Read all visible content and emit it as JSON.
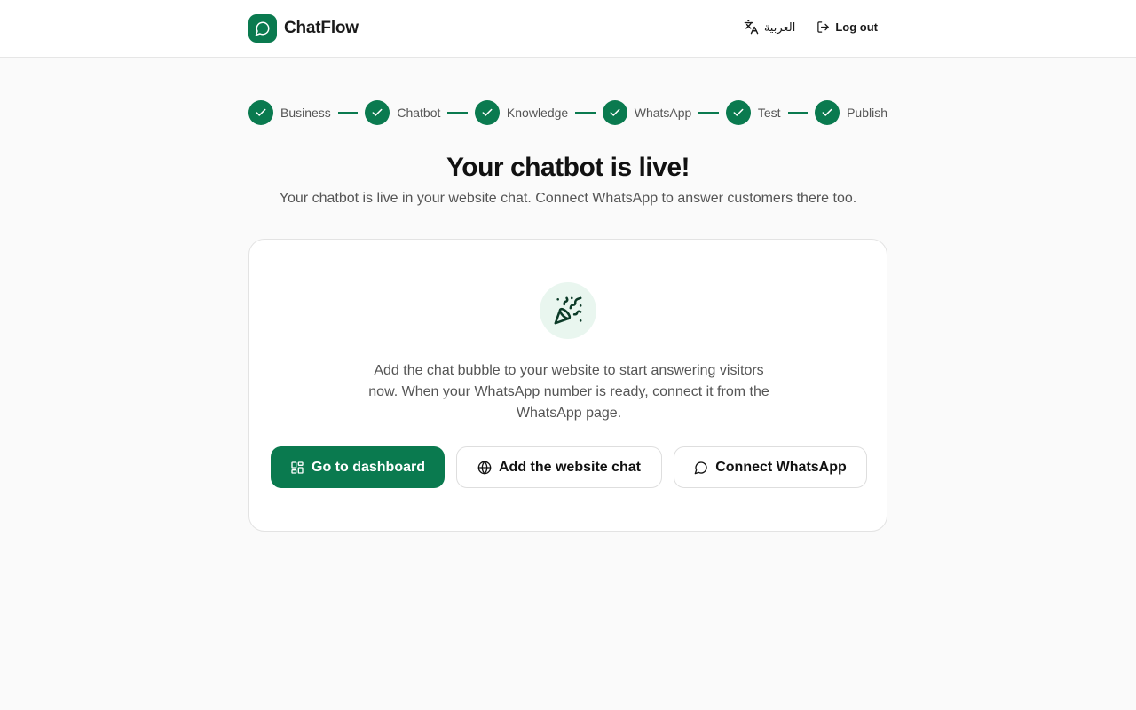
{
  "header": {
    "brand": "ChatFlow",
    "language_label": "العربية",
    "logout_label": "Log out"
  },
  "stepper": {
    "steps": [
      {
        "label": "Business",
        "status": "complete"
      },
      {
        "label": "Chatbot",
        "status": "complete"
      },
      {
        "label": "Knowledge",
        "status": "complete"
      },
      {
        "label": "WhatsApp",
        "status": "complete"
      },
      {
        "label": "Test",
        "status": "complete"
      },
      {
        "label": "Publish",
        "status": "complete"
      }
    ]
  },
  "main": {
    "title": "Your chatbot is live!",
    "subtitle": "Your chatbot is live in your website chat. Connect WhatsApp to answer customers there too."
  },
  "card": {
    "icon": "party-popper-icon",
    "message": "Add the chat bubble to your website to start answering visitors now. When your WhatsApp number is ready, connect it from the WhatsApp page.",
    "buttons": {
      "dashboard": "Go to dashboard",
      "website_chat": "Add the website chat",
      "connect_whatsapp": "Connect WhatsApp"
    }
  },
  "colors": {
    "brand": "#0a7a4f",
    "icon_bg": "#e9f6ef",
    "page_bg": "#fafafa"
  }
}
